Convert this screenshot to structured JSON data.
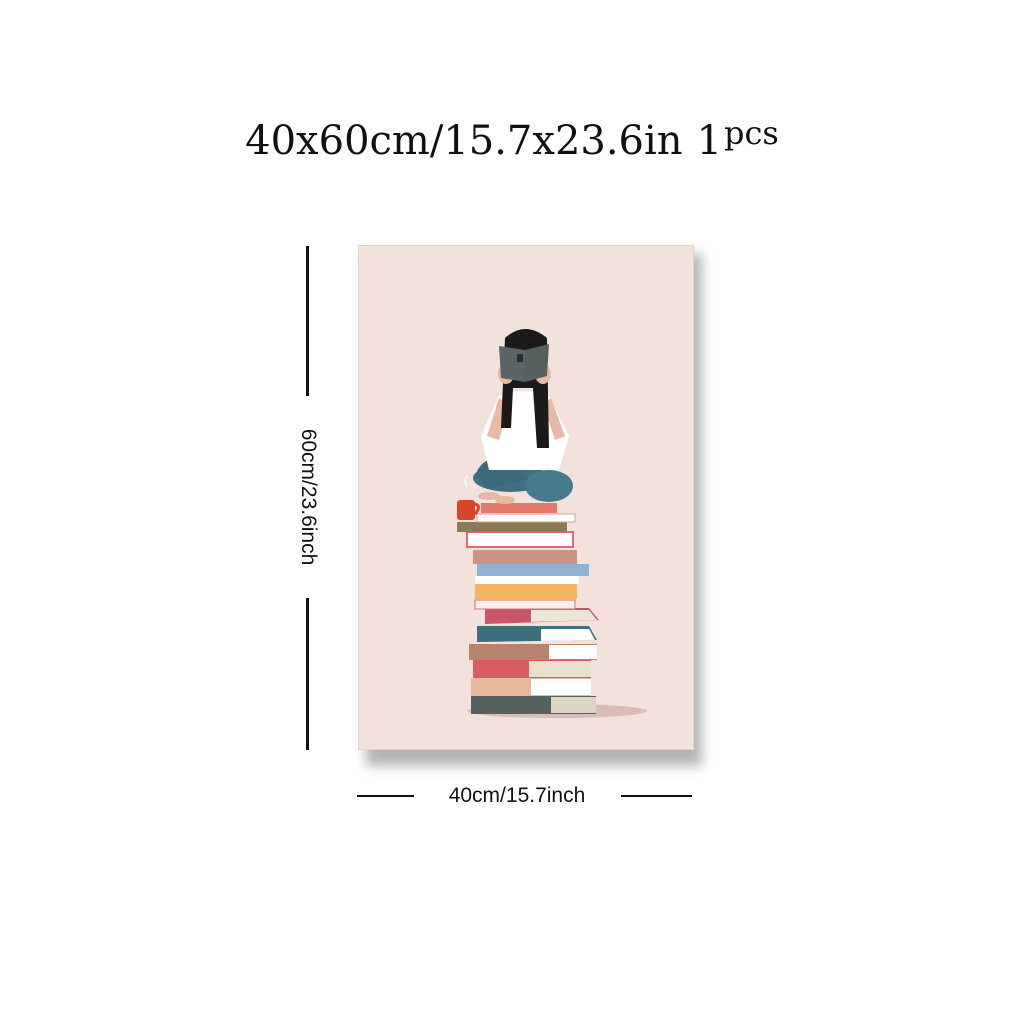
{
  "title": {
    "text": "40x60cm/15.7x23.6in",
    "quantity_number": "1",
    "quantity_unit": "pcs"
  },
  "dimensions": {
    "height_label": "60cm/23.6inch",
    "width_label": "40cm/15.7inch"
  },
  "artwork": {
    "description_colors": {
      "background": "#f3e2dc",
      "hair": "#1a1a1a",
      "book_cover": "#5b6466",
      "shirt": "#ffffff",
      "jeans": "#3f6f80",
      "skin": "#e9b9a3",
      "mug": "#d8462a"
    }
  }
}
